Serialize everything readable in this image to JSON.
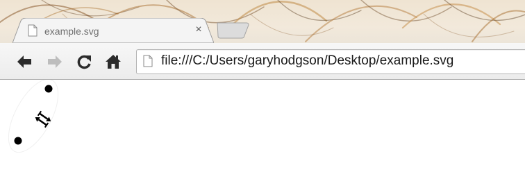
{
  "window": {
    "tab": {
      "title": "example.svg",
      "icon": "page-icon",
      "close_glyph": "×"
    },
    "new_tab_icon": "new-tab-icon"
  },
  "toolbar": {
    "back_icon": "arrow-left-icon",
    "forward_icon": "arrow-right-icon",
    "reload_icon": "reload-icon",
    "home_icon": "home-icon",
    "address": {
      "icon": "page-icon",
      "url": "file:///C:/Users/garyhodgson/Desktop/example.svg"
    }
  },
  "content": {
    "description_icons": [
      "dot",
      "rotate-handle-icon",
      "dot"
    ]
  },
  "colors": {
    "toolbar_bg": "#eeeeee",
    "content_bg": "#ffffff",
    "tab_text": "#6e6e6e",
    "icon_dark": "#2b2b2b",
    "icon_disabled": "#bdbdbd"
  }
}
